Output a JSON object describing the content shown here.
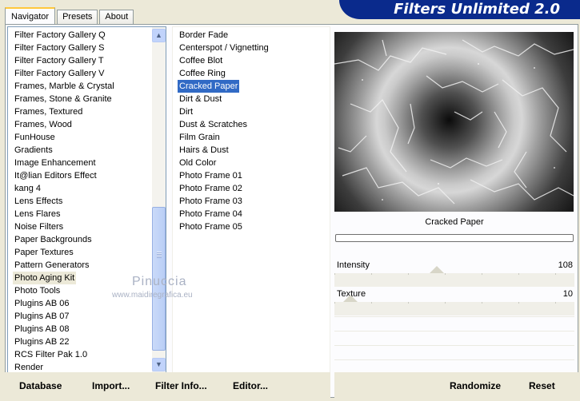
{
  "tabs": [
    "Navigator",
    "Presets",
    "About"
  ],
  "banner_title": "Filters Unlimited 2.0",
  "categories": [
    "Filter Factory Gallery Q",
    "Filter Factory Gallery S",
    "Filter Factory Gallery T",
    "Filter Factory Gallery V",
    "Frames, Marble & Crystal",
    "Frames, Stone & Granite",
    "Frames, Textured",
    "Frames, Wood",
    "FunHouse",
    "Gradients",
    "Image Enhancement",
    "It@lian Editors Effect",
    "kang 4",
    "Lens Effects",
    "Lens Flares",
    "Noise Filters",
    "Paper Backgrounds",
    "Paper Textures",
    "Pattern Generators",
    "Photo Aging Kit",
    "Photo Tools",
    "Plugins AB 06",
    "Plugins AB 07",
    "Plugins AB 08",
    "Plugins AB 22",
    "RCS Filter Pak 1.0",
    "Render"
  ],
  "selected_category": "Photo Aging Kit",
  "filters": [
    "Border Fade",
    "Centerspot / Vignetting",
    "Coffee Blot",
    "Coffee Ring",
    "Cracked Paper",
    "Dirt & Dust",
    "Dirt",
    "Dust & Scratches",
    "Film Grain",
    "Hairs & Dust",
    "Old Color",
    "Photo Frame 01",
    "Photo Frame 02",
    "Photo Frame 03",
    "Photo Frame 04",
    "Photo Frame 05"
  ],
  "selected_filter": "Cracked Paper",
  "preview_filter_name": "Cracked Paper",
  "params": [
    {
      "label": "Intensity",
      "value": "108",
      "max": 255
    },
    {
      "label": "Texture",
      "value": "10",
      "max": 255
    }
  ],
  "buttons": {
    "database": "Database",
    "import": "Import...",
    "filter_info": "Filter Info...",
    "editor": "Editor...",
    "randomize": "Randomize",
    "reset": "Reset"
  },
  "watermark": {
    "line1": "Pinuccia",
    "line2": "www.maidiregrafica.eu"
  },
  "icons": {
    "scroll_up": "▲",
    "scroll_down": "▼"
  },
  "colors": {
    "banner": "#0a2a8c",
    "selection": "#316ac5",
    "tab_accent": "#ffc83c"
  }
}
